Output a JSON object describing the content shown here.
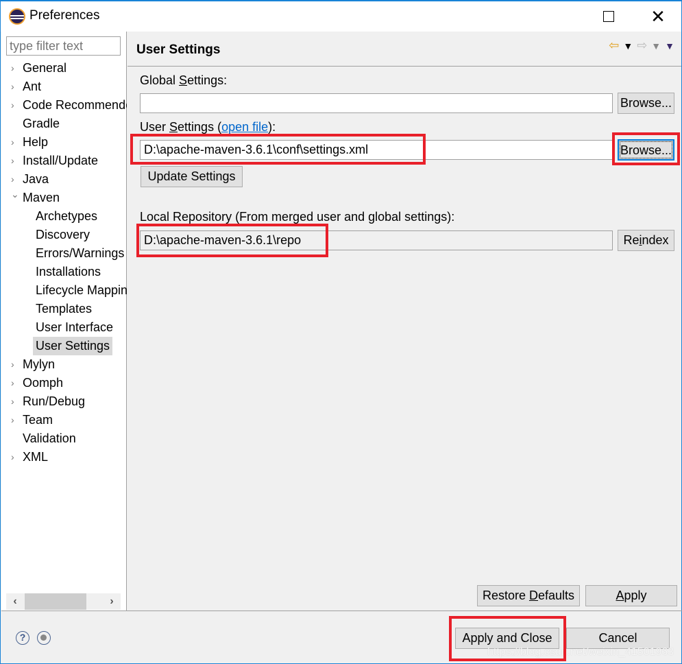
{
  "window": {
    "title": "Preferences",
    "maximize_icon": "maximize-icon",
    "close_icon": "close-icon",
    "close_glyph": "✕"
  },
  "sidebar": {
    "filter_placeholder": "type filter text",
    "filter_value": "",
    "items": [
      {
        "label": "General",
        "expandable": true,
        "expanded": false,
        "level": 0
      },
      {
        "label": "Ant",
        "expandable": true,
        "expanded": false,
        "level": 0
      },
      {
        "label": "Code Recommenders",
        "expandable": true,
        "expanded": false,
        "level": 0
      },
      {
        "label": "Gradle",
        "expandable": false,
        "level": 0
      },
      {
        "label": "Help",
        "expandable": true,
        "expanded": false,
        "level": 0
      },
      {
        "label": "Install/Update",
        "expandable": true,
        "expanded": false,
        "level": 0
      },
      {
        "label": "Java",
        "expandable": true,
        "expanded": false,
        "level": 0
      },
      {
        "label": "Maven",
        "expandable": true,
        "expanded": true,
        "level": 0
      },
      {
        "label": "Archetypes",
        "level": 1
      },
      {
        "label": "Discovery",
        "level": 1
      },
      {
        "label": "Errors/Warnings",
        "level": 1
      },
      {
        "label": "Installations",
        "level": 1
      },
      {
        "label": "Lifecycle Mappings",
        "level": 1
      },
      {
        "label": "Templates",
        "level": 1
      },
      {
        "label": "User Interface",
        "level": 1
      },
      {
        "label": "User Settings",
        "level": 1,
        "selected": true
      },
      {
        "label": "Mylyn",
        "expandable": true,
        "expanded": false,
        "level": 0
      },
      {
        "label": "Oomph",
        "expandable": true,
        "expanded": false,
        "level": 0
      },
      {
        "label": "Run/Debug",
        "expandable": true,
        "expanded": false,
        "level": 0
      },
      {
        "label": "Team",
        "expandable": true,
        "expanded": false,
        "level": 0
      },
      {
        "label": "Validation",
        "expandable": false,
        "level": 0
      },
      {
        "label": "XML",
        "expandable": true,
        "expanded": false,
        "level": 0
      }
    ],
    "scroll_left_glyph": "‹",
    "scroll_right_glyph": "›"
  },
  "page": {
    "title": "User Settings",
    "nav": {
      "back_glyph": "⇦",
      "back_menu_glyph": "▼",
      "forward_glyph": "⇨",
      "forward_menu_glyph": "▼",
      "view_menu_glyph": "▼"
    },
    "global_settings": {
      "label_prefix": "Global ",
      "label_mnemonic": "S",
      "label_suffix": "ettings:",
      "value": "",
      "browse_label": "Browse..."
    },
    "user_settings": {
      "label_prefix": "User ",
      "label_mnemonic": "S",
      "label_mid": "ettings (",
      "link_text": "open file",
      "label_suffix": "):",
      "value": "D:\\apache-maven-3.6.1\\conf\\settings.xml",
      "browse_label": "Browse...",
      "update_label": "Update Settings"
    },
    "local_repository": {
      "label": "Local Repository (From merged user and global settings):",
      "value": "D:\\apache-maven-3.6.1\\repo",
      "reindex_prefix": "Re",
      "reindex_mnemonic": "i",
      "reindex_suffix": "ndex"
    },
    "restore_defaults": {
      "prefix": "Restore ",
      "mnemonic": "D",
      "suffix": "efaults"
    },
    "apply": {
      "mnemonic": "A",
      "suffix": "pply"
    }
  },
  "footer": {
    "help_glyph": "?",
    "apply_and_close_label": "Apply and Close",
    "cancel_label": "Cancel",
    "watermark": "https://blog.csdn.net/weixin_41501963"
  },
  "annotation_color": "#e8202a"
}
